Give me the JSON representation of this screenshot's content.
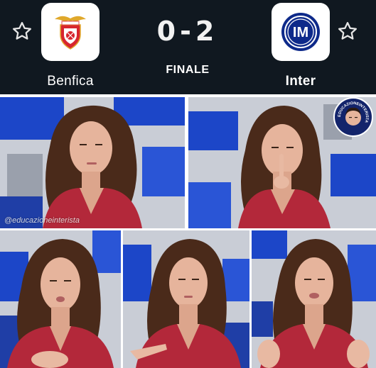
{
  "match": {
    "home_team": "Benfica",
    "away_team": "Inter",
    "score": "0-2",
    "status": "FINALE"
  },
  "icons": {
    "favorite_left": "star-outline-icon",
    "favorite_right": "star-outline-icon",
    "home_crest": "benfica-crest-icon",
    "away_crest": "inter-crest-icon"
  },
  "crest_text": {
    "away_monogram": "IM"
  },
  "overlay": {
    "watermark": "@educazioneinterista",
    "badge_text": "EDUCAZIONEINTERISTA"
  },
  "colors": {
    "header_bg": "#101820",
    "benfica_red": "#d7262e",
    "inter_blue": "#0e2a8a",
    "studio_blue": "#1c46c8",
    "jacket_red": "#b3283a"
  }
}
